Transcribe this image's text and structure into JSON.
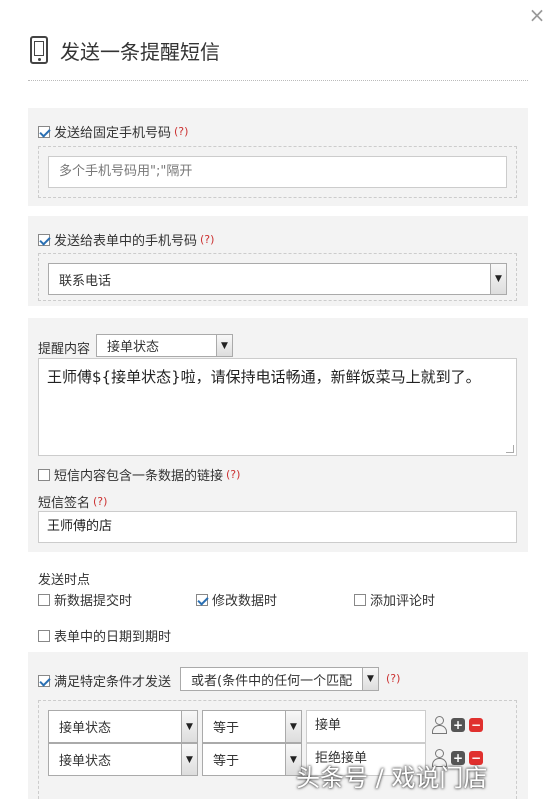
{
  "dialog": {
    "title": "发送一条提醒短信",
    "close_glyph": "×"
  },
  "help_glyph": "(?)",
  "fixed_phone": {
    "label": "发送给固定手机号码",
    "checked": true,
    "placeholder": "多个手机号码用\";\"隔开"
  },
  "form_phone": {
    "label": "发送给表单中的手机号码",
    "checked": true,
    "field": "联系电话"
  },
  "content": {
    "label": "提醒内容",
    "insert_field": "接单状态",
    "text": "王师傅${接单状态}啦，请保持电话畅通，新鲜饭菜马上就到了。",
    "include_link_label": "短信内容包含一条数据的链接",
    "include_link_checked": false
  },
  "signature": {
    "label": "短信签名",
    "value": "王师傅的店"
  },
  "send_timing": {
    "label": "发送时点",
    "options": [
      {
        "label": "新数据提交时",
        "checked": false
      },
      {
        "label": "修改数据时",
        "checked": true
      },
      {
        "label": "添加评论时",
        "checked": false
      },
      {
        "label": "表单中的日期到期时",
        "checked": false
      }
    ]
  },
  "conditions": {
    "label": "满足特定条件才发送",
    "checked": true,
    "mode": "或者(条件中的任何一个匹配",
    "rows": [
      {
        "field": "接单状态",
        "operator": "等于",
        "value": "接单"
      },
      {
        "field": "接单状态",
        "operator": "等于",
        "value": "拒绝接单"
      }
    ]
  },
  "icons": {
    "close": "close-icon",
    "phone": "mobile-phone-icon",
    "user": "user-icon",
    "add": "plus-icon",
    "remove": "minus-icon"
  },
  "colors": {
    "help": "#cc3333",
    "remove": "#e0302e",
    "panel_bg": "#f3f3f3"
  },
  "watermark": "头条号 / 戏说门店"
}
